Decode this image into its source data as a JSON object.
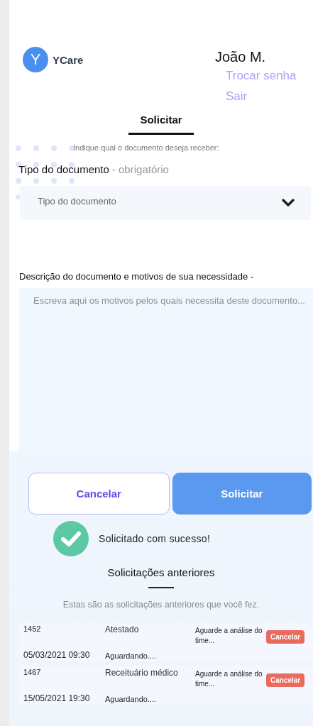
{
  "brand": {
    "logo_letter": "Y",
    "name": "YCare"
  },
  "user": {
    "name": "João M.",
    "links": [
      "Trocar senha",
      "Sair"
    ]
  },
  "tabs": [
    {
      "label": "Solicitar",
      "selected": true
    }
  ],
  "form": {
    "instruction": "Indique qual o documento deseja receber:",
    "type_label": "Tipo do documento",
    "type_hint": "- obrigatório",
    "type_select": {
      "placeholder": "Tipo do documento"
    },
    "description_label": "Descrição do documento e motivos de sua necessidade -",
    "description": {
      "placeholder": "Escreva aqui os motivos pelos quais necessita deste documento..."
    },
    "buttons": [
      {
        "label": "Cancelar",
        "kind": "secondary"
      },
      {
        "label": "Solicitar",
        "kind": "primary"
      }
    ],
    "success": "Solicitado com sucesso!"
  },
  "history": {
    "title": "Solicitações anteriores",
    "subtitle": "Estas são as solicitações anteriores que você fez.",
    "rows": [
      {
        "id": "1452",
        "date": "05/03/2021 09:30",
        "type": "Atestado",
        "status": "Aguardando....",
        "note": "Aguarde a análise do time...",
        "action": "Cancelar"
      },
      {
        "id": "1467",
        "date": "15/05/2021 19:30",
        "type": "Receituário médico",
        "status": "Aguardando....",
        "note": "Aguarde a análise do time...",
        "action": "Cancelar"
      }
    ]
  }
}
